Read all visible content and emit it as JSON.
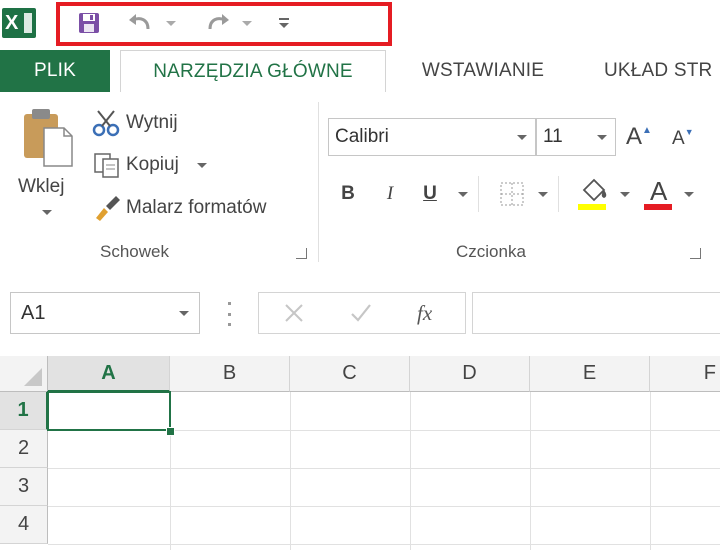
{
  "app": {
    "logo_letter": "X"
  },
  "tabs": [
    {
      "label": "PLIK"
    },
    {
      "label": "NARZĘDZIA GŁÓWNE"
    },
    {
      "label": "WSTAWIANIE"
    },
    {
      "label": "UKŁAD STR"
    }
  ],
  "clipboard": {
    "paste_label": "Wklej",
    "cut_label": "Wytnij",
    "copy_label": "Kopiuj",
    "format_painter_label": "Malarz formatów",
    "group_label": "Schowek"
  },
  "font": {
    "name_value": "Calibri",
    "size_value": "11",
    "bold_label": "B",
    "italic_label": "I",
    "underline_label": "U",
    "font_color_label": "A",
    "grow_label": "A",
    "shrink_label": "A",
    "group_label": "Czcionka"
  },
  "formula_bar": {
    "name_box_value": "A1",
    "fx_label": "fx",
    "formula_value": ""
  },
  "grid": {
    "columns": [
      "A",
      "B",
      "C",
      "D",
      "E",
      "F"
    ],
    "rows": [
      "1",
      "2",
      "3",
      "4"
    ]
  },
  "colors": {
    "excel_green": "#217346",
    "highlight_red": "#e51c23",
    "fill_yellow": "#ffff00",
    "font_red": "#e51c23",
    "save_purple": "#7b4fa6"
  }
}
